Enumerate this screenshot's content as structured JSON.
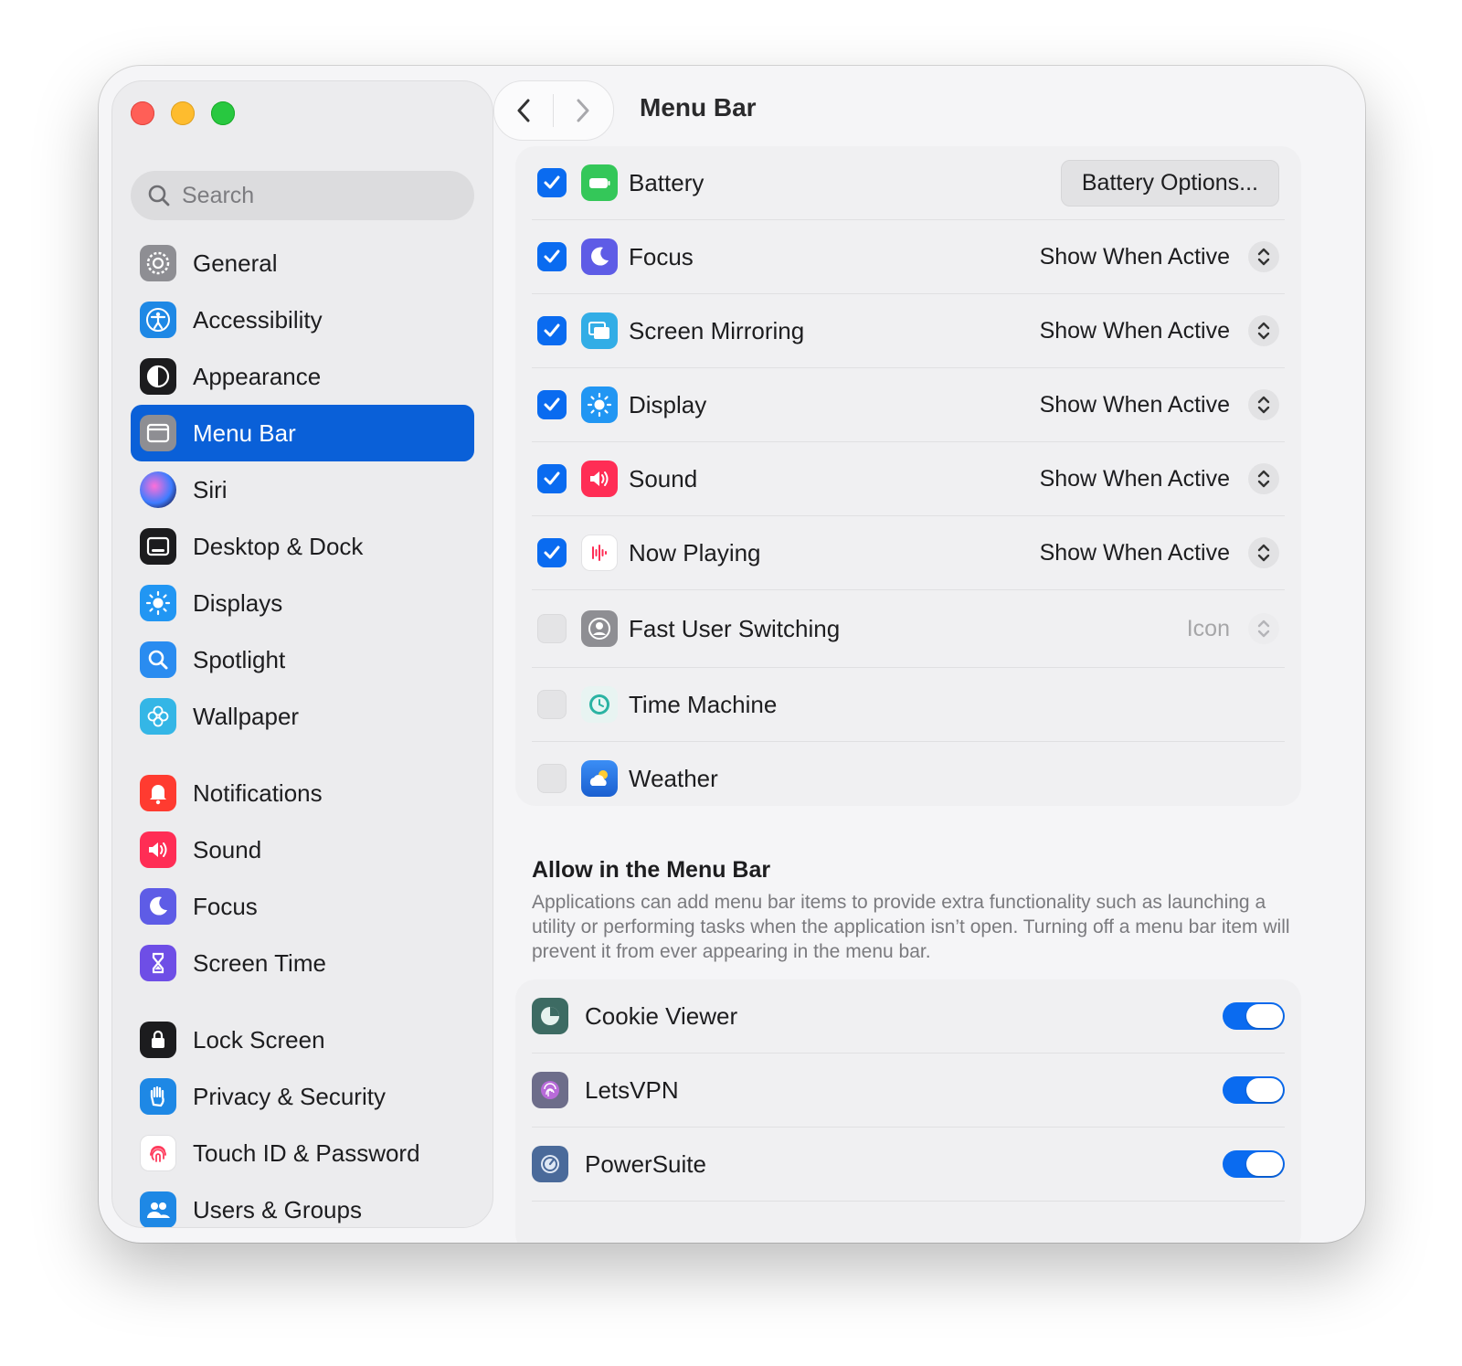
{
  "window": {
    "title": "Menu Bar"
  },
  "sidebar": {
    "search_placeholder": "Search",
    "items": [
      {
        "label": "General",
        "icon": "gear-icon",
        "color": "#8e8e93"
      },
      {
        "label": "Accessibility",
        "icon": "accessibility-icon",
        "color": "#1e88e5"
      },
      {
        "label": "Appearance",
        "icon": "appearance-icon",
        "color": "#1c1c1e"
      },
      {
        "label": "Menu Bar",
        "icon": "menubar-icon",
        "color": "#8e8e93",
        "selected": true
      },
      {
        "label": "Siri",
        "icon": "siri-icon",
        "color": "#3a2a7a"
      },
      {
        "label": "Desktop & Dock",
        "icon": "dock-icon",
        "color": "#1c1c1e"
      },
      {
        "label": "Displays",
        "icon": "sun-icon",
        "color": "#2196f3"
      },
      {
        "label": "Spotlight",
        "icon": "magnifier-icon",
        "color": "#2a8cf0"
      },
      {
        "label": "Wallpaper",
        "icon": "flower-icon",
        "color": "#34b6e6"
      },
      {
        "label": "Notifications",
        "icon": "bell-icon",
        "color": "#ff3b30"
      },
      {
        "label": "Sound",
        "icon": "speaker-icon",
        "color": "#ff2d55"
      },
      {
        "label": "Focus",
        "icon": "moon-icon",
        "color": "#5e5ce6"
      },
      {
        "label": "Screen Time",
        "icon": "hourglass-icon",
        "color": "#6e4ee6"
      },
      {
        "label": "Lock Screen",
        "icon": "lock-icon",
        "color": "#1c1c1e"
      },
      {
        "label": "Privacy & Security",
        "icon": "hand-icon",
        "color": "#1e88e5"
      },
      {
        "label": "Touch ID & Password",
        "icon": "fingerprint-icon",
        "color": "#ffffff"
      },
      {
        "label": "Users & Groups",
        "icon": "users-icon",
        "color": "#1e88e5"
      }
    ]
  },
  "controls": [
    {
      "label": "Battery",
      "checked": true,
      "icon": "battery-icon",
      "color": "#34c759",
      "button": "Battery Options..."
    },
    {
      "label": "Focus",
      "checked": true,
      "icon": "moon-icon",
      "color": "#5e5ce6",
      "option": "Show When Active"
    },
    {
      "label": "Screen Mirroring",
      "checked": true,
      "icon": "mirroring-icon",
      "color": "#32ade6",
      "option": "Show When Active"
    },
    {
      "label": "Display",
      "checked": true,
      "icon": "sun-icon",
      "color": "#2196f3",
      "option": "Show When Active"
    },
    {
      "label": "Sound",
      "checked": true,
      "icon": "speaker-icon",
      "color": "#ff2d55",
      "option": "Show When Active"
    },
    {
      "label": "Now Playing",
      "checked": true,
      "icon": "waveform-icon",
      "color": "#ffffff",
      "option": "Show When Active"
    },
    {
      "label": "Fast User Switching",
      "checked": false,
      "icon": "user-circle-icon",
      "color": "#8e8e93",
      "option": "Icon",
      "disabled": true
    },
    {
      "label": "Time Machine",
      "checked": false,
      "icon": "time-machine-icon",
      "color": "#e8f4f2"
    },
    {
      "label": "Weather",
      "checked": false,
      "icon": "weather-icon",
      "color": "#1e6fd9"
    }
  ],
  "allow": {
    "title": "Allow in the Menu Bar",
    "description": "Applications can add menu bar items to provide extra functionality such as launching a utility or performing tasks when the application isn’t open. Turning off a menu bar item will prevent it from ever appearing in the menu bar.",
    "apps": [
      {
        "label": "Cookie Viewer",
        "icon": "cookie-viewer-icon",
        "color": "#3d6b63",
        "enabled": true
      },
      {
        "label": "LetsVPN",
        "icon": "letsvpn-icon",
        "color": "#6d6d8a",
        "enabled": true
      },
      {
        "label": "PowerSuite",
        "icon": "powersuite-icon",
        "color": "#4a6a9a",
        "enabled": true
      }
    ]
  },
  "colors": {
    "accent": "#0a60d8",
    "checkbox": "#0a6bf0"
  }
}
